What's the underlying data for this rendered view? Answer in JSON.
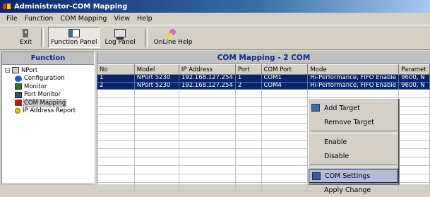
{
  "window": {
    "title": "Administrator-COM Mapping"
  },
  "menubar": [
    {
      "label": "File"
    },
    {
      "label": "Function"
    },
    {
      "label": "COM Mapping"
    },
    {
      "label": "View"
    },
    {
      "label": "Help"
    }
  ],
  "toolbar": {
    "exit_label": "Exit",
    "function_panel_label": "Function Panel",
    "log_panel_label": "Log Panel",
    "online_help_label": "OnLine Help"
  },
  "left_panel": {
    "header": "Function",
    "tree": {
      "root": "NPort",
      "items": [
        {
          "label": "Configuration",
          "icon": "config-icon"
        },
        {
          "label": "Monitor",
          "icon": "monitor-icon"
        },
        {
          "label": "Port Monitor",
          "icon": "port-monitor-icon"
        },
        {
          "label": "COM Mapping",
          "icon": "com-mapping-icon",
          "selected": true
        },
        {
          "label": "IP Address Report",
          "icon": "ip-report-icon"
        }
      ]
    }
  },
  "right_panel": {
    "header": "COM Mapping - 2 COM",
    "columns": [
      "No",
      "Model",
      "IP Address",
      "Port",
      "COM Port",
      "Mode",
      "Paramet"
    ],
    "rows": [
      [
        "1",
        "NPort 5230",
        "192.168.127.254",
        "1",
        "COM1",
        "Hi-Performance, FIFO Enable",
        "9600, N"
      ],
      [
        "2",
        "NPort 5230",
        "192.168.127.254",
        "2",
        "COM4",
        "Hi-Performance, FIFO Enable",
        "9600, N"
      ]
    ]
  },
  "context_menu": {
    "items": [
      {
        "label": "Add Target",
        "icon": "add-target-icon"
      },
      {
        "label": "Remove Target"
      },
      {
        "label": "Enable"
      },
      {
        "label": "Disable"
      },
      {
        "label": "COM Settings",
        "icon": "com-settings-icon",
        "highlighted": true
      },
      {
        "label": "Apply Change"
      }
    ]
  },
  "colors": {
    "title_bar": "#0a246a",
    "selection": "#0a246a",
    "header_text": "#0b2a8a",
    "menu_highlight": "#b6bdd2"
  }
}
